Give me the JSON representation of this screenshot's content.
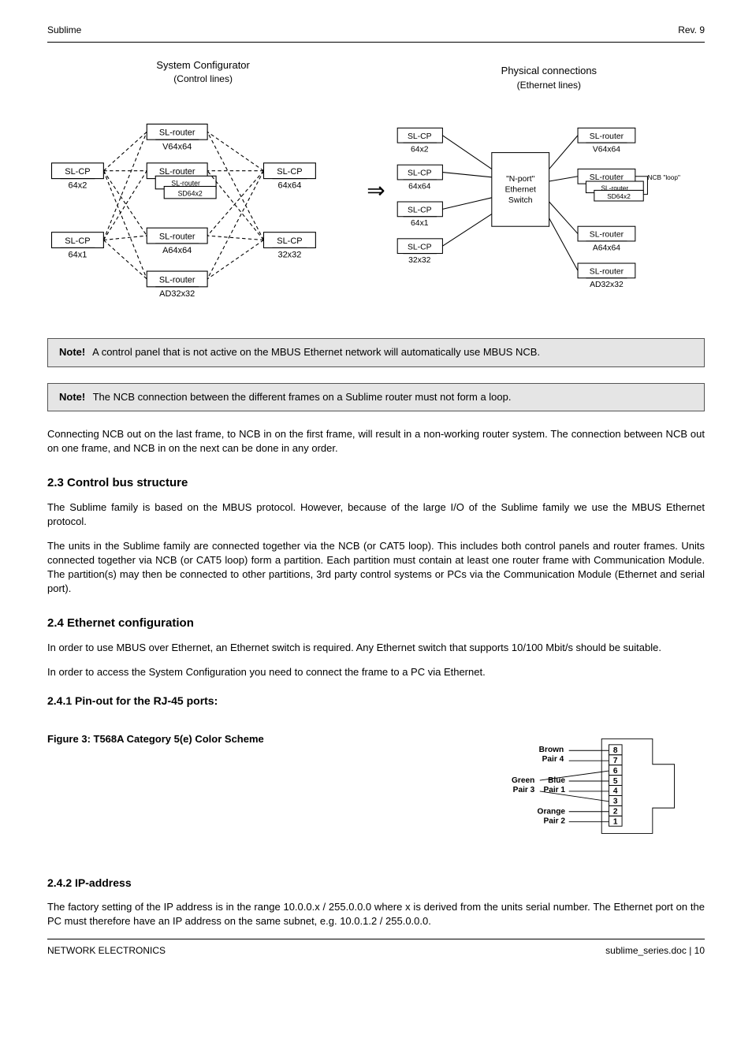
{
  "header": {
    "left": "Sublime",
    "right": "Rev. 9"
  },
  "footer": {
    "left": "NETWORK ELECTRONICS",
    "right": "sublime_series.doc  |  10"
  },
  "diag": {
    "left_title": "System Configurator",
    "left_sub": "(Control lines)",
    "right_title": "Physical connections",
    "right_sub": "(Ethernet lines)",
    "left_boxes": {
      "cp1": "SL-CP",
      "cp1s": "64x2",
      "cp2": "SL-CP",
      "cp2s": "64x1",
      "r1": "SL-router",
      "r1s": "V64x64",
      "r2": "SL-router",
      "r2s": "SL-router",
      "sd": "SD64x2",
      "r3": "SL-router",
      "r3s": "A64x64",
      "r4": "SL-router",
      "r4s": "AD32x32",
      "cp3": "SL-CP",
      "cp3s": "64x64",
      "cp4": "SL-CP",
      "cp4s": "32x32"
    },
    "right_boxes": {
      "switch": "\"N-port\"\nEthernet\nSwitch",
      "cp1": "SL-CP",
      "cp1s": "64x2",
      "cp2": "SL-CP",
      "cp2s": "64x64",
      "cp3": "SL-CP",
      "cp3s": "64x1",
      "cp4": "SL-CP",
      "cp4s": "32x32",
      "r1": "SL-router",
      "r1s": "V64x64",
      "r2": "SL-router",
      "r2s": "SL-router",
      "sd": "SD64x2",
      "r3": "SL-router",
      "r3s": "A64x64",
      "r4": "SL-router",
      "r4s": "AD32x32",
      "loop": "NCB \"loop\""
    }
  },
  "note1": {
    "label": "Note!",
    "text": "A control panel that is not active on the MBUS Ethernet network will automatically use MBUS NCB."
  },
  "note2": {
    "label": "Note!",
    "text": "The NCB connection between the different frames on a Sublime router must not form a loop."
  },
  "para_after_notes": "Connecting NCB out on the last frame, to NCB in on the first frame, will result in a non-working router system. The connection between NCB out on one frame, and NCB in on the next can be done in any order.",
  "sec_control": {
    "title": "2.3  Control bus structure",
    "p1": "The Sublime family is based on the MBUS protocol. However, because of the large I/O of the Sublime family we use the MBUS Ethernet protocol.",
    "p2": "The units in the Sublime family are connected together via the NCB (or CAT5 loop). This includes both control panels and router frames. Units connected together via NCB (or CAT5 loop) form a partition. Each partition must contain at least one router frame with Communication Module. The partition(s) may then be connected to other partitions, 3rd party control systems or PCs via the Communication Module (Ethernet and serial port)."
  },
  "sec_eth": {
    "title": "2.4  Ethernet configuration",
    "p1": "In order to use MBUS over Ethernet, an Ethernet switch is required. Any Ethernet switch that supports 10/100 Mbit/s should be suitable.",
    "p2": "In order to access the System Configuration you need to connect the frame to a PC via Ethernet."
  },
  "sec_pinout": {
    "title": "2.4.1 Pin-out for the RJ-45 ports:",
    "caption": "Figure 3: T568A Category 5(e) Color Scheme",
    "labels": {
      "brown": "Brown\nPair 4",
      "green": "Green\nPair 3",
      "blue": "Blue\nPair 1",
      "orange": "Orange\nPair 2"
    },
    "pins": [
      "8",
      "7",
      "6",
      "5",
      "4",
      "3",
      "2",
      "1"
    ]
  },
  "sec_ip": {
    "title": "2.4.2 IP-address",
    "p1": "The factory setting of the IP address is in the range 10.0.0.x / 255.0.0.0 where x is derived from the units serial number. The Ethernet port on the PC must therefore have an IP address on the same subnet, e.g. 10.0.1.2 / 255.0.0.0."
  }
}
